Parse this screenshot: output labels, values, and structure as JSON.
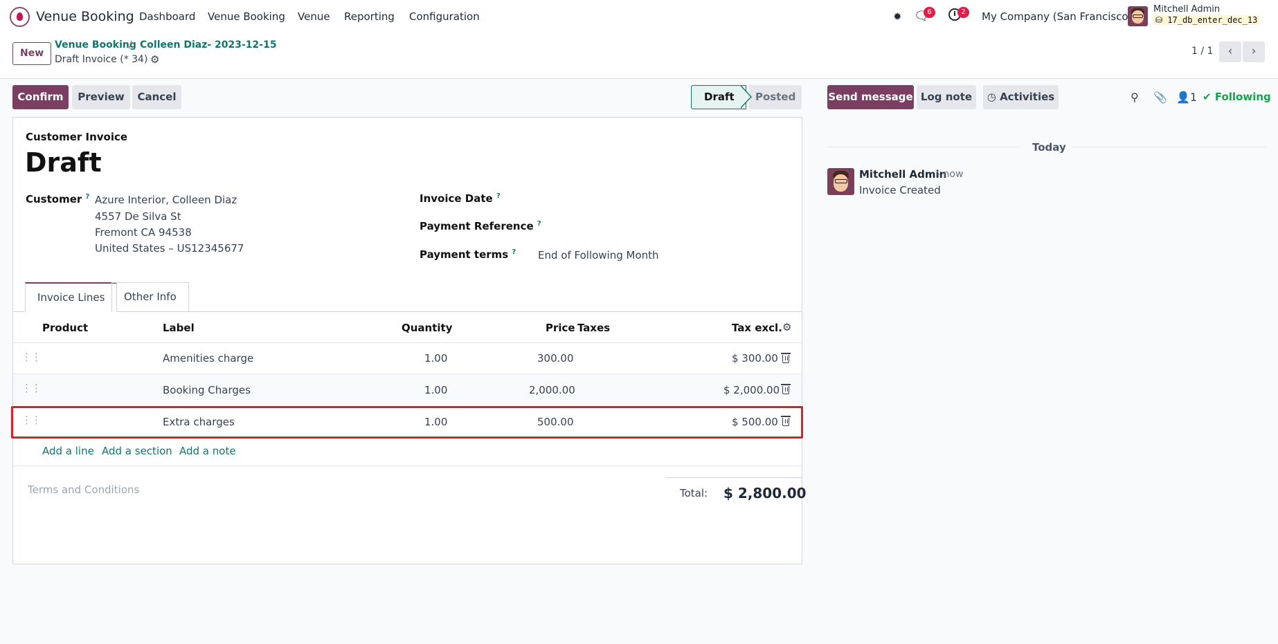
{
  "nav": {
    "app_name": "Venue Booking",
    "menu": [
      "Dashboard",
      "Venue Booking",
      "Venue",
      "Reporting",
      "Configuration"
    ],
    "messages_count": "6",
    "activities_count": "2",
    "company": "My Company (San Francisco)",
    "user_name": "Mitchell Admin",
    "database": "17_db_enter_dec_13"
  },
  "control_panel": {
    "new_label": "New",
    "breadcrumbs": [
      "Venue Booking",
      "Colleen Diaz- 2023-12-15"
    ],
    "breadcrumb_separator": "/",
    "record_title": "Draft Invoice (* 34)",
    "pager": "1 / 1"
  },
  "actions": {
    "confirm": "Confirm",
    "preview": "Preview",
    "cancel": "Cancel",
    "statuses": [
      "Draft",
      "Posted"
    ],
    "active_status": "Draft"
  },
  "invoice": {
    "type": "Customer Invoice",
    "title": "Draft",
    "customer_label": "Customer",
    "customer_lines": [
      "Azure Interior, Colleen Diaz",
      "4557 De Silva St",
      "Fremont CA 94538",
      "United States – US12345677"
    ],
    "invoice_date_label": "Invoice Date",
    "payment_reference_label": "Payment Reference",
    "payment_terms_label": "Payment terms",
    "payment_terms_value": "End of Following Month",
    "help_mark": "?"
  },
  "tabs": [
    "Invoice Lines",
    "Other Info"
  ],
  "lines": {
    "headers": [
      "Product",
      "Label",
      "Quantity",
      "Price",
      "Taxes",
      "Tax excl."
    ],
    "rows": [
      {
        "product": "",
        "label": "Amenities charge",
        "quantity": "1.00",
        "price": "300.00",
        "taxes": "",
        "subtotal": "$ 300.00"
      },
      {
        "product": "",
        "label": "Booking Charges",
        "quantity": "1.00",
        "price": "2,000.00",
        "taxes": "",
        "subtotal": "$ 2,000.00"
      },
      {
        "product": "",
        "label": "Extra charges",
        "quantity": "1.00",
        "price": "500.00",
        "taxes": "",
        "subtotal": "$ 500.00"
      }
    ],
    "add_line": "Add a line",
    "add_section": "Add a section",
    "add_note": "Add a note",
    "terms_placeholder": "Terms and Conditions",
    "total_label": "Total:",
    "total_value": "$ 2,800.00"
  },
  "chatter": {
    "send_message": "Send message",
    "log_note": "Log note",
    "activities": "Activities",
    "followers_count": "1",
    "following": "Following",
    "date_separator": "Today",
    "message_author": "Mitchell Admin",
    "message_time": "- now",
    "message_body": "Invoice Created"
  },
  "colors": {
    "brand": "#7a3e63",
    "link": "#0f766e",
    "highlight": "#e11d2a",
    "following": "#16a34a"
  }
}
